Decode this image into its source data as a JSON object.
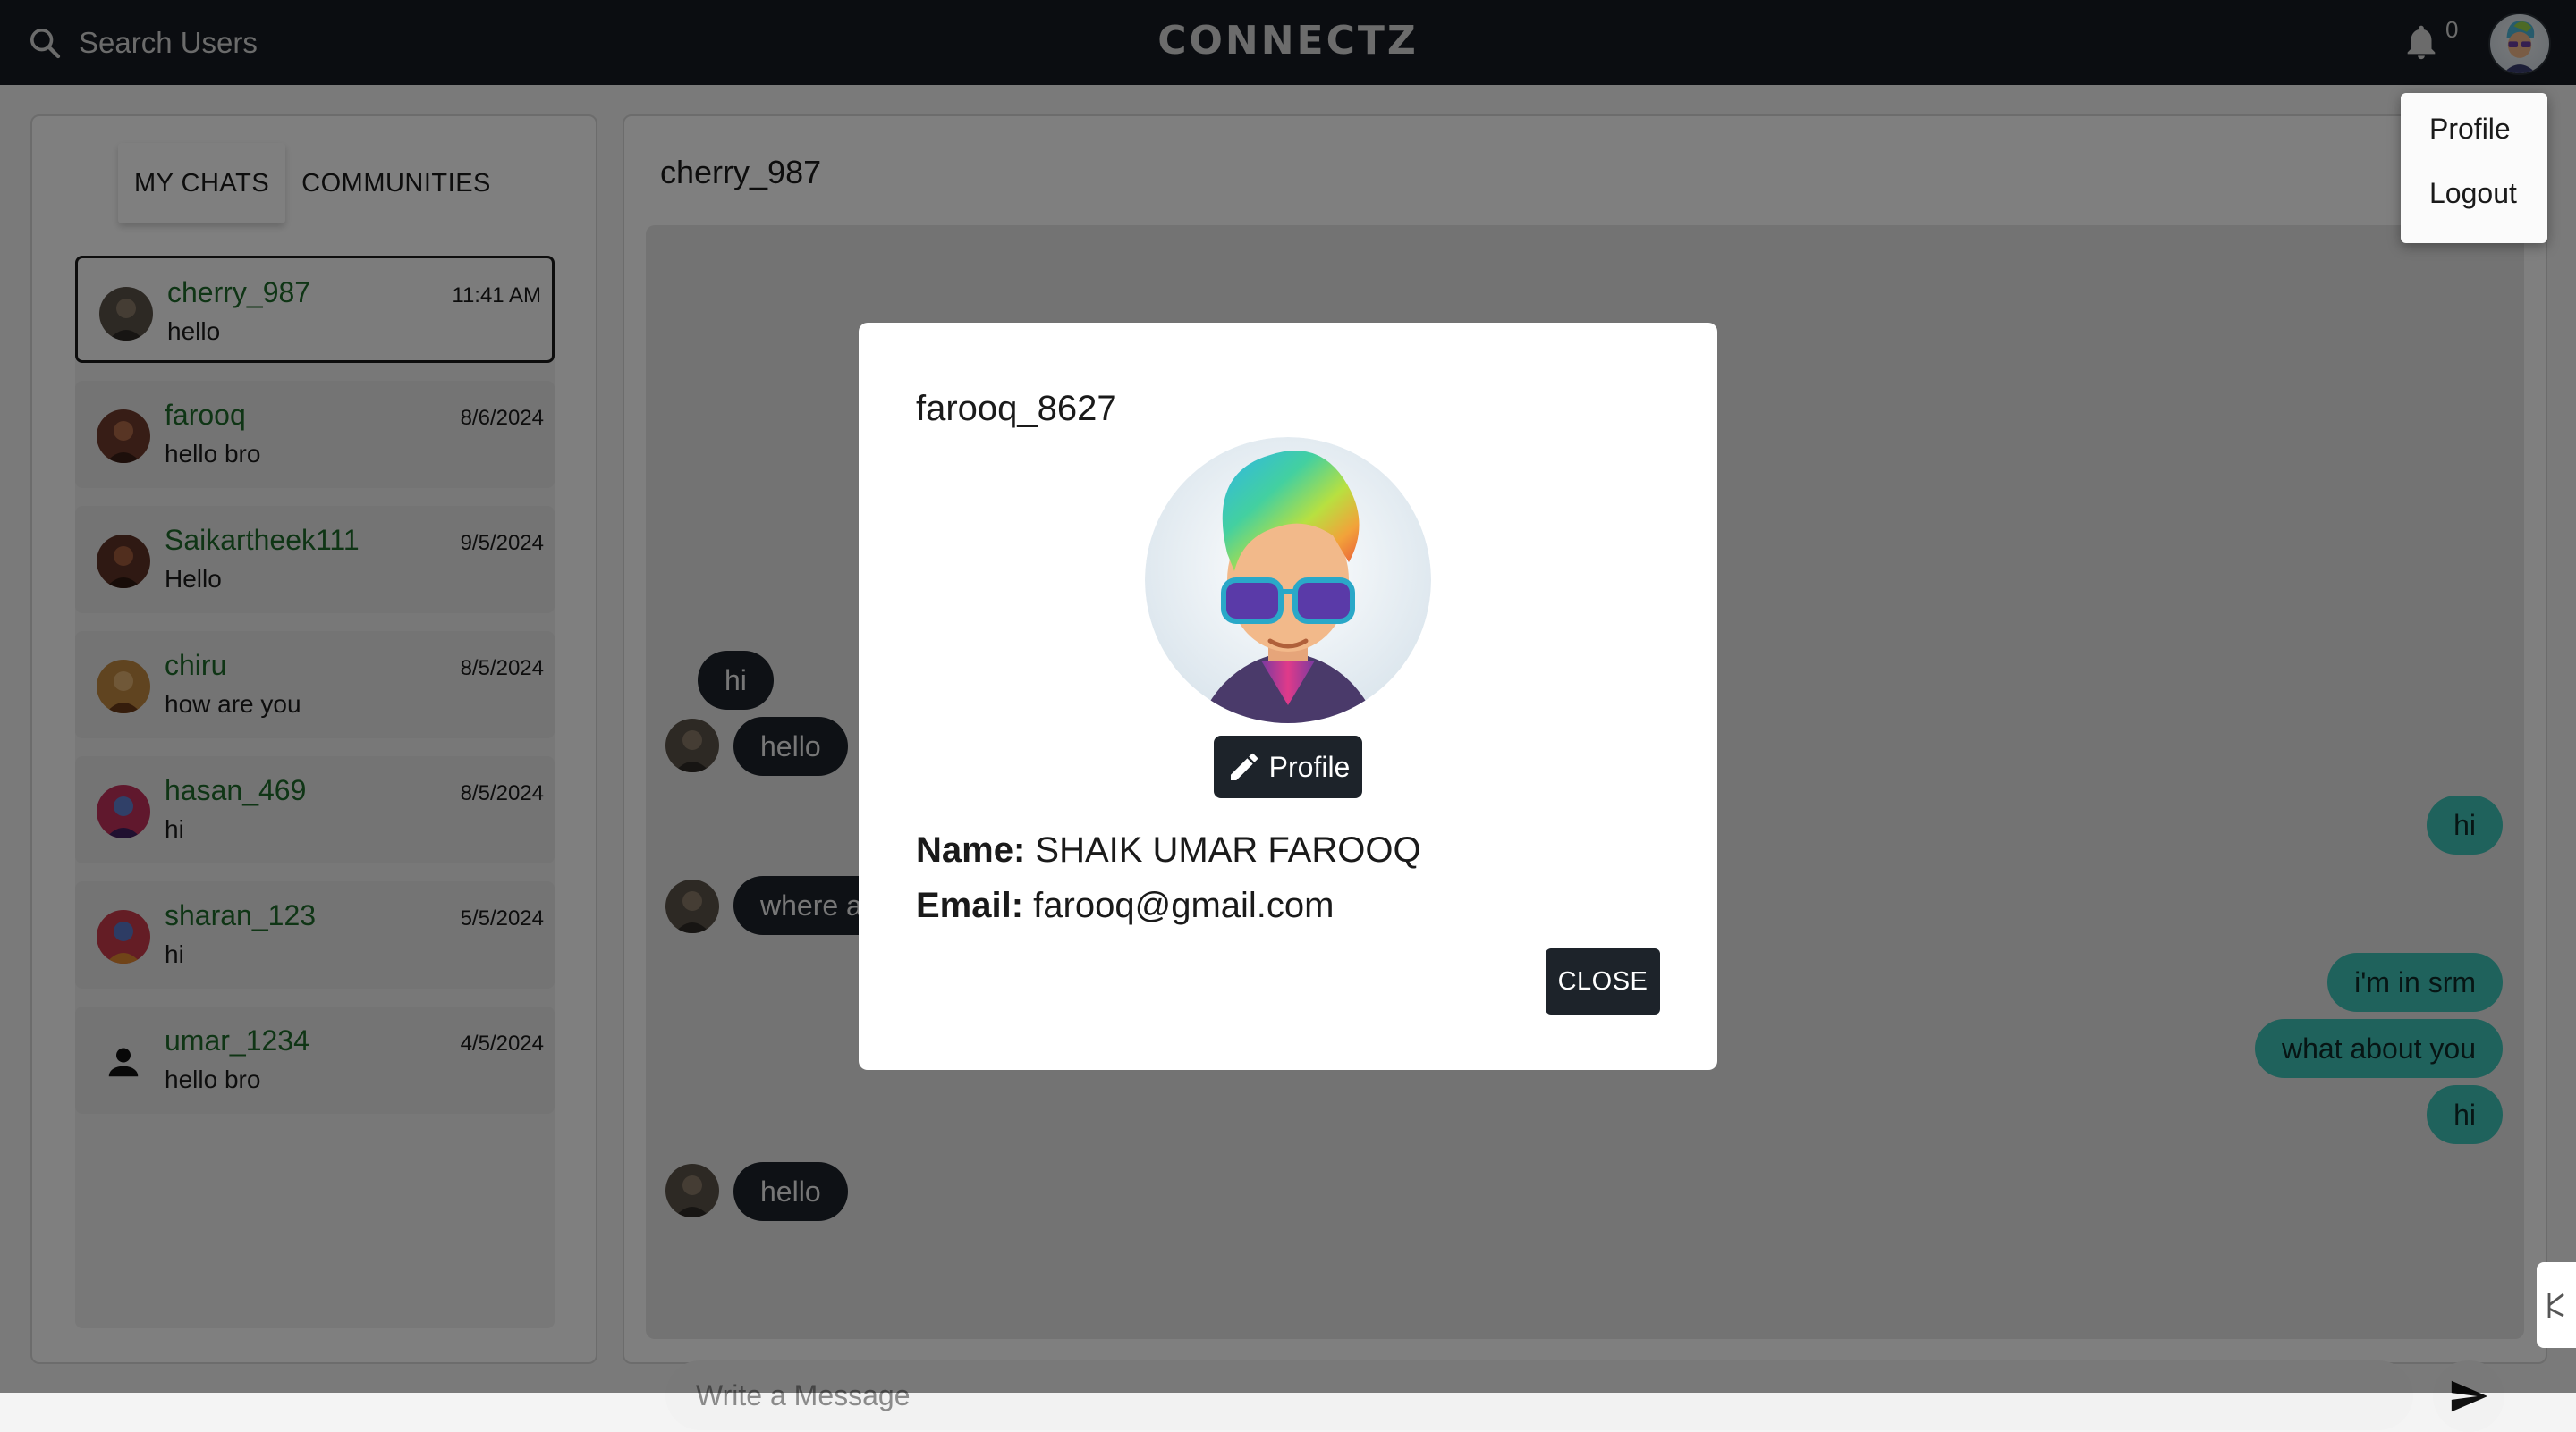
{
  "topbar": {
    "search_label": "Search Users",
    "brand": "CONNECTZ",
    "notification_count": "0",
    "dropdown": {
      "profile": "Profile",
      "logout": "Logout"
    }
  },
  "tabs": {
    "my_chats": "MY CHATS",
    "communities": "COMMUNITIES"
  },
  "chats": [
    {
      "name": "cherry_987",
      "message": "hello",
      "time": "11:41 AM",
      "active": true
    },
    {
      "name": "farooq",
      "message": "hello bro",
      "time": "8/6/2024"
    },
    {
      "name": "Saikartheek111",
      "message": "Hello",
      "time": "9/5/2024"
    },
    {
      "name": "chiru",
      "message": "how are you",
      "time": "8/5/2024"
    },
    {
      "name": "hasan_469",
      "message": "hi",
      "time": "8/5/2024"
    },
    {
      "name": "sharan_123",
      "message": "hi",
      "time": "5/5/2024"
    },
    {
      "name": "umar_1234",
      "message": "hello bro",
      "time": "4/5/2024"
    }
  ],
  "conversation": {
    "title": "cherry_987",
    "messages": [
      {
        "text": "hi",
        "side": "in"
      },
      {
        "text": "hello",
        "side": "in"
      },
      {
        "text": "hi",
        "side": "out"
      },
      {
        "text": "where are you",
        "side": "in"
      },
      {
        "text": "i'm in srm",
        "side": "out"
      },
      {
        "text": "what about you",
        "side": "out"
      },
      {
        "text": "hi",
        "side": "out"
      },
      {
        "text": "hello",
        "side": "in"
      }
    ],
    "input_placeholder": "Write a Message"
  },
  "modal": {
    "title": "farooq_8627",
    "edit_label": "Profile",
    "name_label": "Name:",
    "name_value": "SHAIK UMAR FAROOQ",
    "email_label": "Email:",
    "email_value": "farooq@gmail.com",
    "close_label": "CLOSE"
  },
  "colors": {
    "topbar": "#161b22",
    "contact_name": "#1e6b2b",
    "incoming_bubble": "#1d232a",
    "outgoing_bubble": "#3ec4b8"
  }
}
